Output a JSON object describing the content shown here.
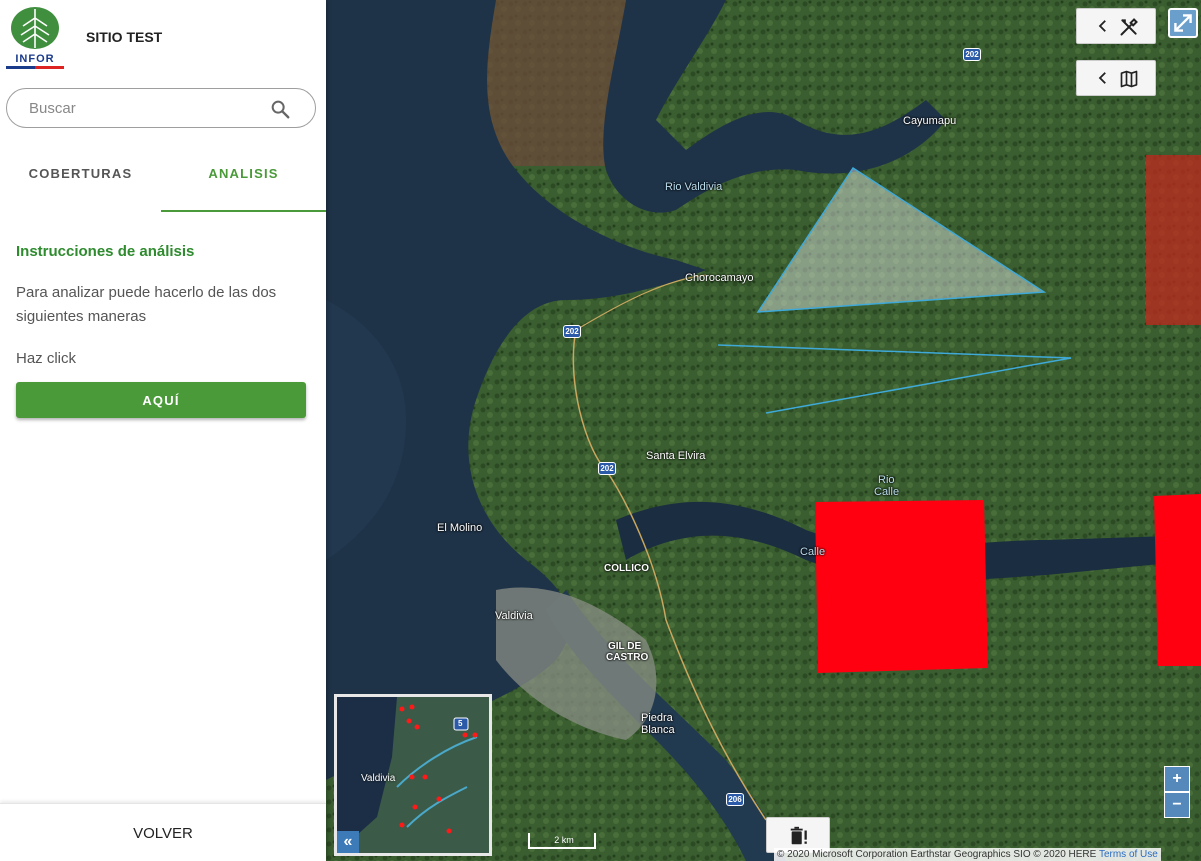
{
  "app": {
    "brand_text": "INFOR",
    "site_title": "SITIO TEST"
  },
  "search": {
    "placeholder": "Buscar"
  },
  "tabs": [
    {
      "label": "COBERTURAS",
      "active": false
    },
    {
      "label": "ANALISIS",
      "active": true
    }
  ],
  "analysis": {
    "title": "Instrucciones de análisis",
    "text": "Para analizar puede hacerlo de las dos siguientes maneras",
    "click_text": "Haz click",
    "button": "AQUÍ"
  },
  "footer": {
    "button": "VOLVER"
  },
  "map": {
    "labels": {
      "cayumapu": "Cayumapu",
      "rio_valdivia": "Rio Valdivia",
      "chorocamayo": "Chorocamayo",
      "santa_elvira": "Santa Elvira",
      "el_molino": "El Molino",
      "collico": "COLLICO",
      "valdivia": "Valdivia",
      "gil_de": "GIL DE",
      "castro": "CASTRO",
      "piedra": "Piedra",
      "blanca": "Blanca",
      "rio": "Rio",
      "calle": "Calle",
      "calle2": "Calle"
    },
    "routes": [
      "202",
      "202",
      "202",
      "206"
    ],
    "overview": {
      "label": "Valdivia",
      "route": "5",
      "collapse": "«"
    },
    "scale": "2 km",
    "zoom_in": "+",
    "zoom_out": "−",
    "attribution": "© 2020 Microsoft Corporation Earthstar Geographics SIO © 2020 HERE",
    "terms": "Terms of Use",
    "colors": {
      "accent": "#4a9a3a",
      "title_green": "#2e8b2e",
      "polygon_red": "#ff0010"
    }
  }
}
